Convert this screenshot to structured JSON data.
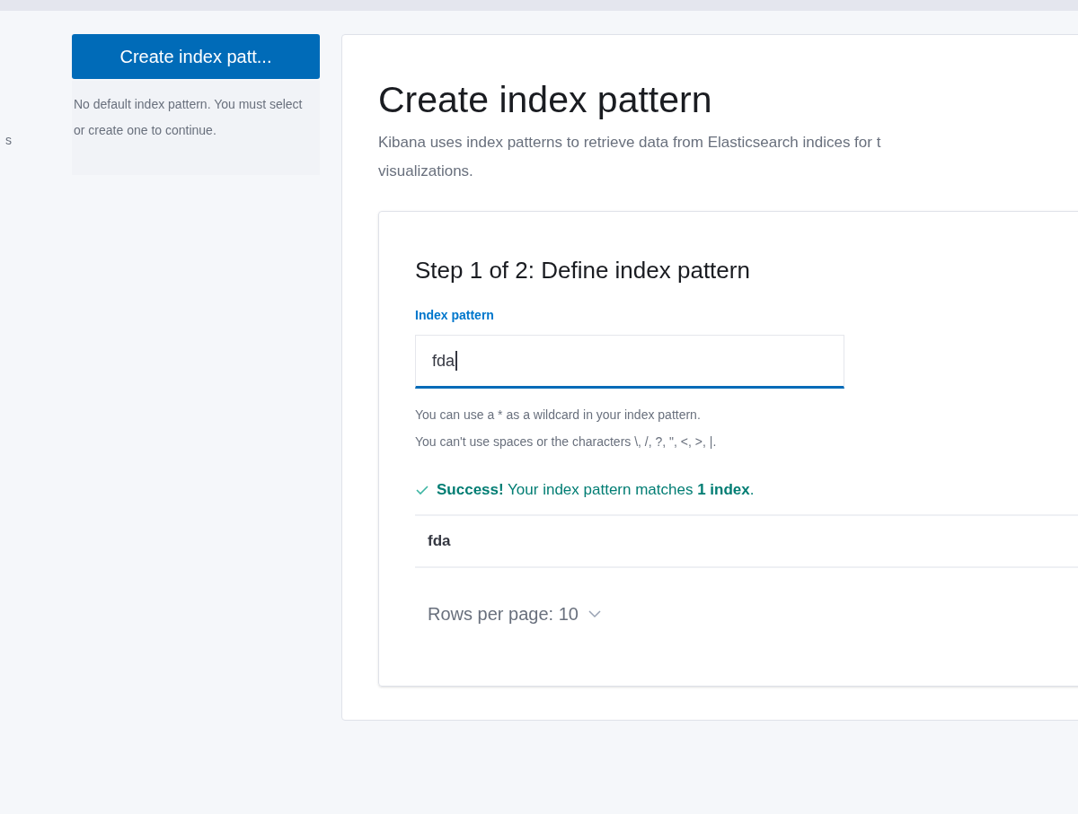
{
  "edge_fragment": "s",
  "sidebar": {
    "create_button": "Create index patt...",
    "notice": "No default index pattern. You must select or create one to continue."
  },
  "main": {
    "title": "Create index pattern",
    "description_lines": [
      "Kibana uses index patterns to retrieve data from Elasticsearch indices for t",
      "visualizations."
    ],
    "step": {
      "title": "Step 1 of 2: Define index pattern",
      "field": {
        "label": "Index pattern",
        "value": "fda",
        "focused": true
      },
      "help_lines": [
        "You can use a * as a wildcard in your index pattern.",
        "You can't use spaces or the characters \\, /, ?, \", <, >, |."
      ],
      "success": "**Success!** Your index pattern matches **1 index**.",
      "rows": [
        "fda"
      ],
      "pagination": "Rows per page: 10"
    }
  }
}
